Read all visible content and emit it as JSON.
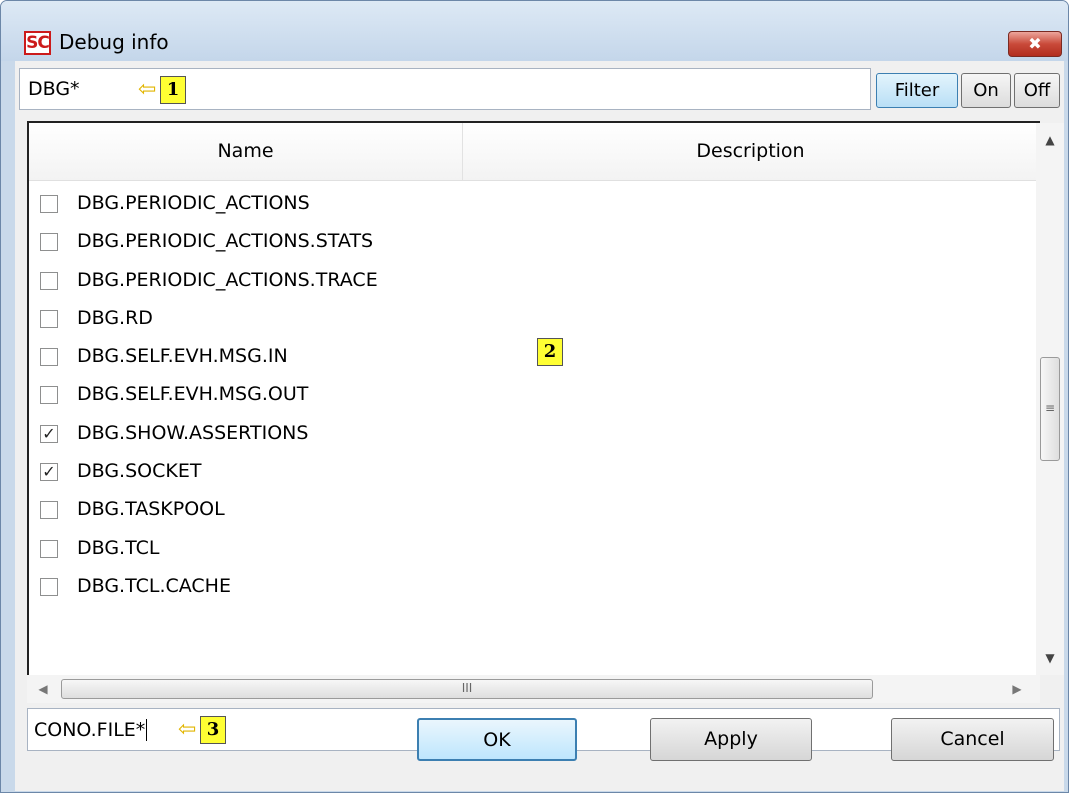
{
  "window": {
    "app_icon_text": "SC",
    "title": "Debug info",
    "close_glyph": "✖"
  },
  "filter": {
    "value": "DBG*",
    "callout_number": "1",
    "buttons": {
      "filter": "Filter",
      "on": "On",
      "off": "Off"
    }
  },
  "list": {
    "columns": {
      "name": "Name",
      "description": "Description"
    },
    "badge_number": "2",
    "items": [
      {
        "label": "DBG.PERIODIC_ACTIONS",
        "checked": false
      },
      {
        "label": "DBG.PERIODIC_ACTIONS.STATS",
        "checked": false
      },
      {
        "label": "DBG.PERIODIC_ACTIONS.TRACE",
        "checked": false
      },
      {
        "label": "DBG.RD",
        "checked": false
      },
      {
        "label": "DBG.SELF.EVH.MSG.IN",
        "checked": false
      },
      {
        "label": "DBG.SELF.EVH.MSG.OUT",
        "checked": false
      },
      {
        "label": "DBG.SHOW.ASSERTIONS",
        "checked": true
      },
      {
        "label": "DBG.SOCKET",
        "checked": true
      },
      {
        "label": "DBG.TASKPOOL",
        "checked": false
      },
      {
        "label": "DBG.TCL",
        "checked": false
      },
      {
        "label": "DBG.TCL.CACHE",
        "checked": false
      }
    ]
  },
  "scrollbars": {
    "up_arrow": "▲",
    "down_arrow": "▼",
    "left_arrow": "◀",
    "right_arrow": "▶",
    "v_grip": "≡",
    "h_grip": "III"
  },
  "bottom": {
    "value": "CONO.FILE*",
    "callout_number": "3"
  },
  "dialog_buttons": {
    "ok": "OK",
    "apply": "Apply",
    "cancel": "Cancel"
  }
}
